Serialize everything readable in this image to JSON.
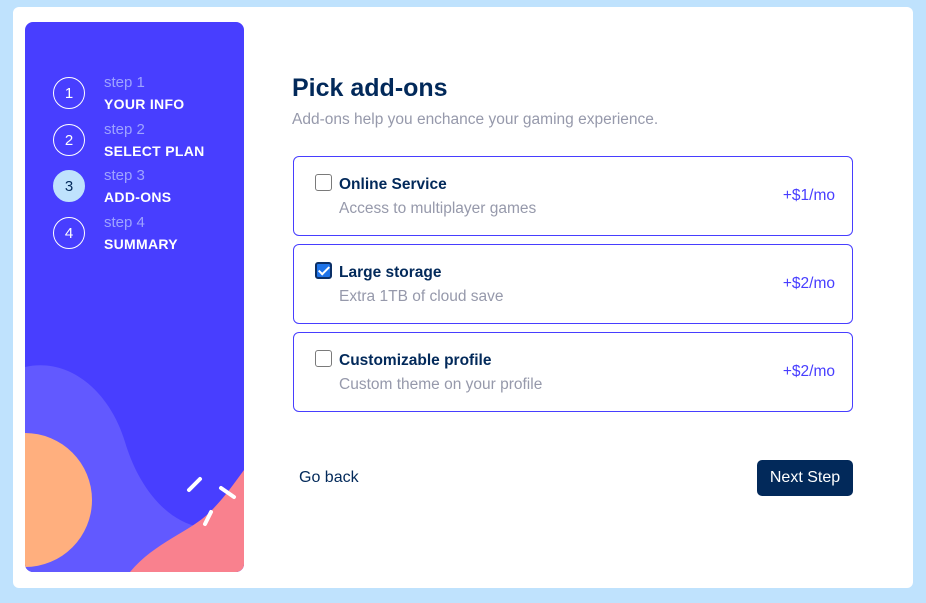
{
  "steps": [
    {
      "number": "1",
      "sub": "step 1",
      "title": "YOUR INFO",
      "active": false
    },
    {
      "number": "2",
      "sub": "step 2",
      "title": "SELECT PLAN",
      "active": false
    },
    {
      "number": "3",
      "sub": "step 3",
      "title": "ADD-ONS",
      "active": true
    },
    {
      "number": "4",
      "sub": "step 4",
      "title": "SUMMARY",
      "active": false
    }
  ],
  "main": {
    "title": "Pick add-ons",
    "subtitle": "Add-ons help you enchance your gaming experience."
  },
  "addons": [
    {
      "name": "Online Service",
      "description": "Access to multiplayer games",
      "price": "+$1/mo",
      "checked": false
    },
    {
      "name": "Large storage",
      "description": "Extra 1TB of cloud save",
      "price": "+$2/mo",
      "checked": true
    },
    {
      "name": "Customizable profile",
      "description": "Custom theme on your profile",
      "price": "+$2/mo",
      "checked": false
    }
  ],
  "footer": {
    "back_label": "Go back",
    "next_label": "Next Step"
  },
  "colors": {
    "page_bg": "#bfe2fd",
    "sidebar_bg": "#483eff",
    "active_step": "#bfe2fd",
    "primary_text": "#02295a",
    "muted_text": "#9699ab",
    "accent": "#483eff",
    "decor_orange": "#ffaf7e",
    "decor_pink": "#f9818e",
    "decor_lilac": "#6259ff"
  }
}
